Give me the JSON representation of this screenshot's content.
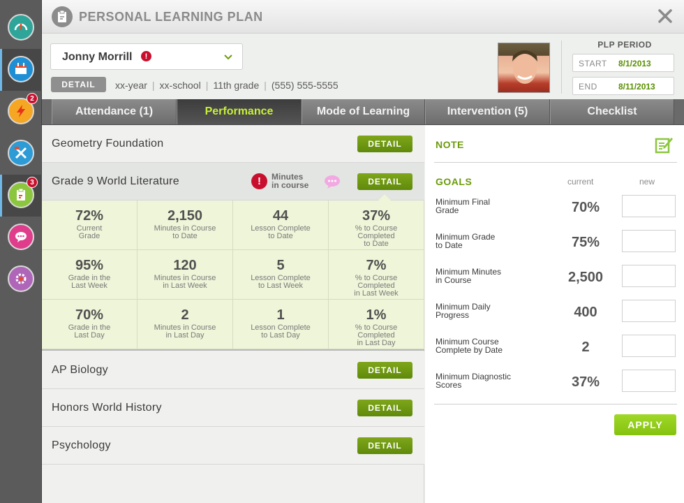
{
  "window": {
    "title": "PERSONAL LEARNING PLAN"
  },
  "nav": {
    "items": [
      {
        "icon": "gauge-icon",
        "badge": ""
      },
      {
        "icon": "calendar-icon",
        "badge": ""
      },
      {
        "icon": "lightning-icon",
        "badge": "2"
      },
      {
        "icon": "tools-icon",
        "badge": ""
      },
      {
        "icon": "clipboard-icon",
        "badge": "3"
      },
      {
        "icon": "chat-icon",
        "badge": ""
      },
      {
        "icon": "settings-icon",
        "badge": ""
      }
    ]
  },
  "student": {
    "name": "Jonny Morrill",
    "alert": "!",
    "detail_label": "DETAIL",
    "year": "xx-year",
    "school": "xx-school",
    "grade": "11th grade",
    "phone": "(555) 555-5555",
    "sep": "|"
  },
  "period": {
    "title": "PLP PERIOD",
    "start_label": "START",
    "start_value": "8/1/2013",
    "end_label": "END",
    "end_value": "8/11/2013"
  },
  "tabs": [
    {
      "label": "Attendance (1)"
    },
    {
      "label": "Performance"
    },
    {
      "label": "Mode of Learning"
    },
    {
      "label": "Intervention (5)"
    },
    {
      "label": "Checklist"
    }
  ],
  "courses": {
    "detail_label": "DETAIL",
    "geometry": "Geometry Foundation",
    "literature": "Grade 9 World Literature",
    "literature_warning_line1": "Minutes",
    "literature_warning_line2": "in course",
    "biology": "AP Biology",
    "history": "Honors World History",
    "psychology": "Psychology"
  },
  "stats": [
    [
      {
        "value": "72%",
        "l1": "Current",
        "l2": "Grade",
        "l3": ""
      },
      {
        "value": "2,150",
        "l1": "Minutes in Course",
        "l2": "to Date",
        "l3": ""
      },
      {
        "value": "44",
        "l1": "Lesson Complete",
        "l2": "to Date",
        "l3": ""
      },
      {
        "value": "37%",
        "l1": "% to Course",
        "l2": "Completed",
        "l3": "to Date"
      }
    ],
    [
      {
        "value": "95%",
        "l1": "Grade in the",
        "l2": "Last Week",
        "l3": ""
      },
      {
        "value": "120",
        "l1": "Minutes in Course",
        "l2": "in Last Week",
        "l3": ""
      },
      {
        "value": "5",
        "l1": "Lesson Complete",
        "l2": "to Last Week",
        "l3": ""
      },
      {
        "value": "7%",
        "l1": "% to Course",
        "l2": "Completed",
        "l3": "in Last Week"
      }
    ],
    [
      {
        "value": "70%",
        "l1": "Grade in the",
        "l2": "Last Day",
        "l3": ""
      },
      {
        "value": "2",
        "l1": "Minutes in Course",
        "l2": "in Last Day",
        "l3": ""
      },
      {
        "value": "1",
        "l1": "Lesson Complete",
        "l2": "to Last Day",
        "l3": ""
      },
      {
        "value": "1%",
        "l1": "% to Course",
        "l2": "Completed",
        "l3": "in Last Day"
      }
    ]
  ],
  "goals": {
    "note_label": "NOTE",
    "title": "GOALS",
    "current_header": "current",
    "new_header": "new",
    "rows": [
      {
        "l1": "Minimum Final",
        "l2": "Grade",
        "current": "70%",
        "new": ""
      },
      {
        "l1": "Minimum Grade",
        "l2": "to Date",
        "current": "75%",
        "new": ""
      },
      {
        "l1": "Minimum Minutes",
        "l2": "in Course",
        "current": "2,500",
        "new": ""
      },
      {
        "l1": "Minimum Daily",
        "l2": "Progress",
        "current": "400",
        "new": ""
      },
      {
        "l1": "Minimum Course",
        "l2": "Complete by Date",
        "current": "2",
        "new": ""
      },
      {
        "l1": "Minimum Diagnostic",
        "l2": "Scores",
        "current": "37%",
        "new": ""
      }
    ],
    "apply_label": "APPLY"
  },
  "colors": {
    "accent_green": "#6d9b0d",
    "button_green": "#5f8a0a",
    "apply_green": "#85c20f",
    "active_tab_text": "#c7f03a",
    "alert_red": "#c8102e",
    "stats_bg": "#eef5d8"
  }
}
